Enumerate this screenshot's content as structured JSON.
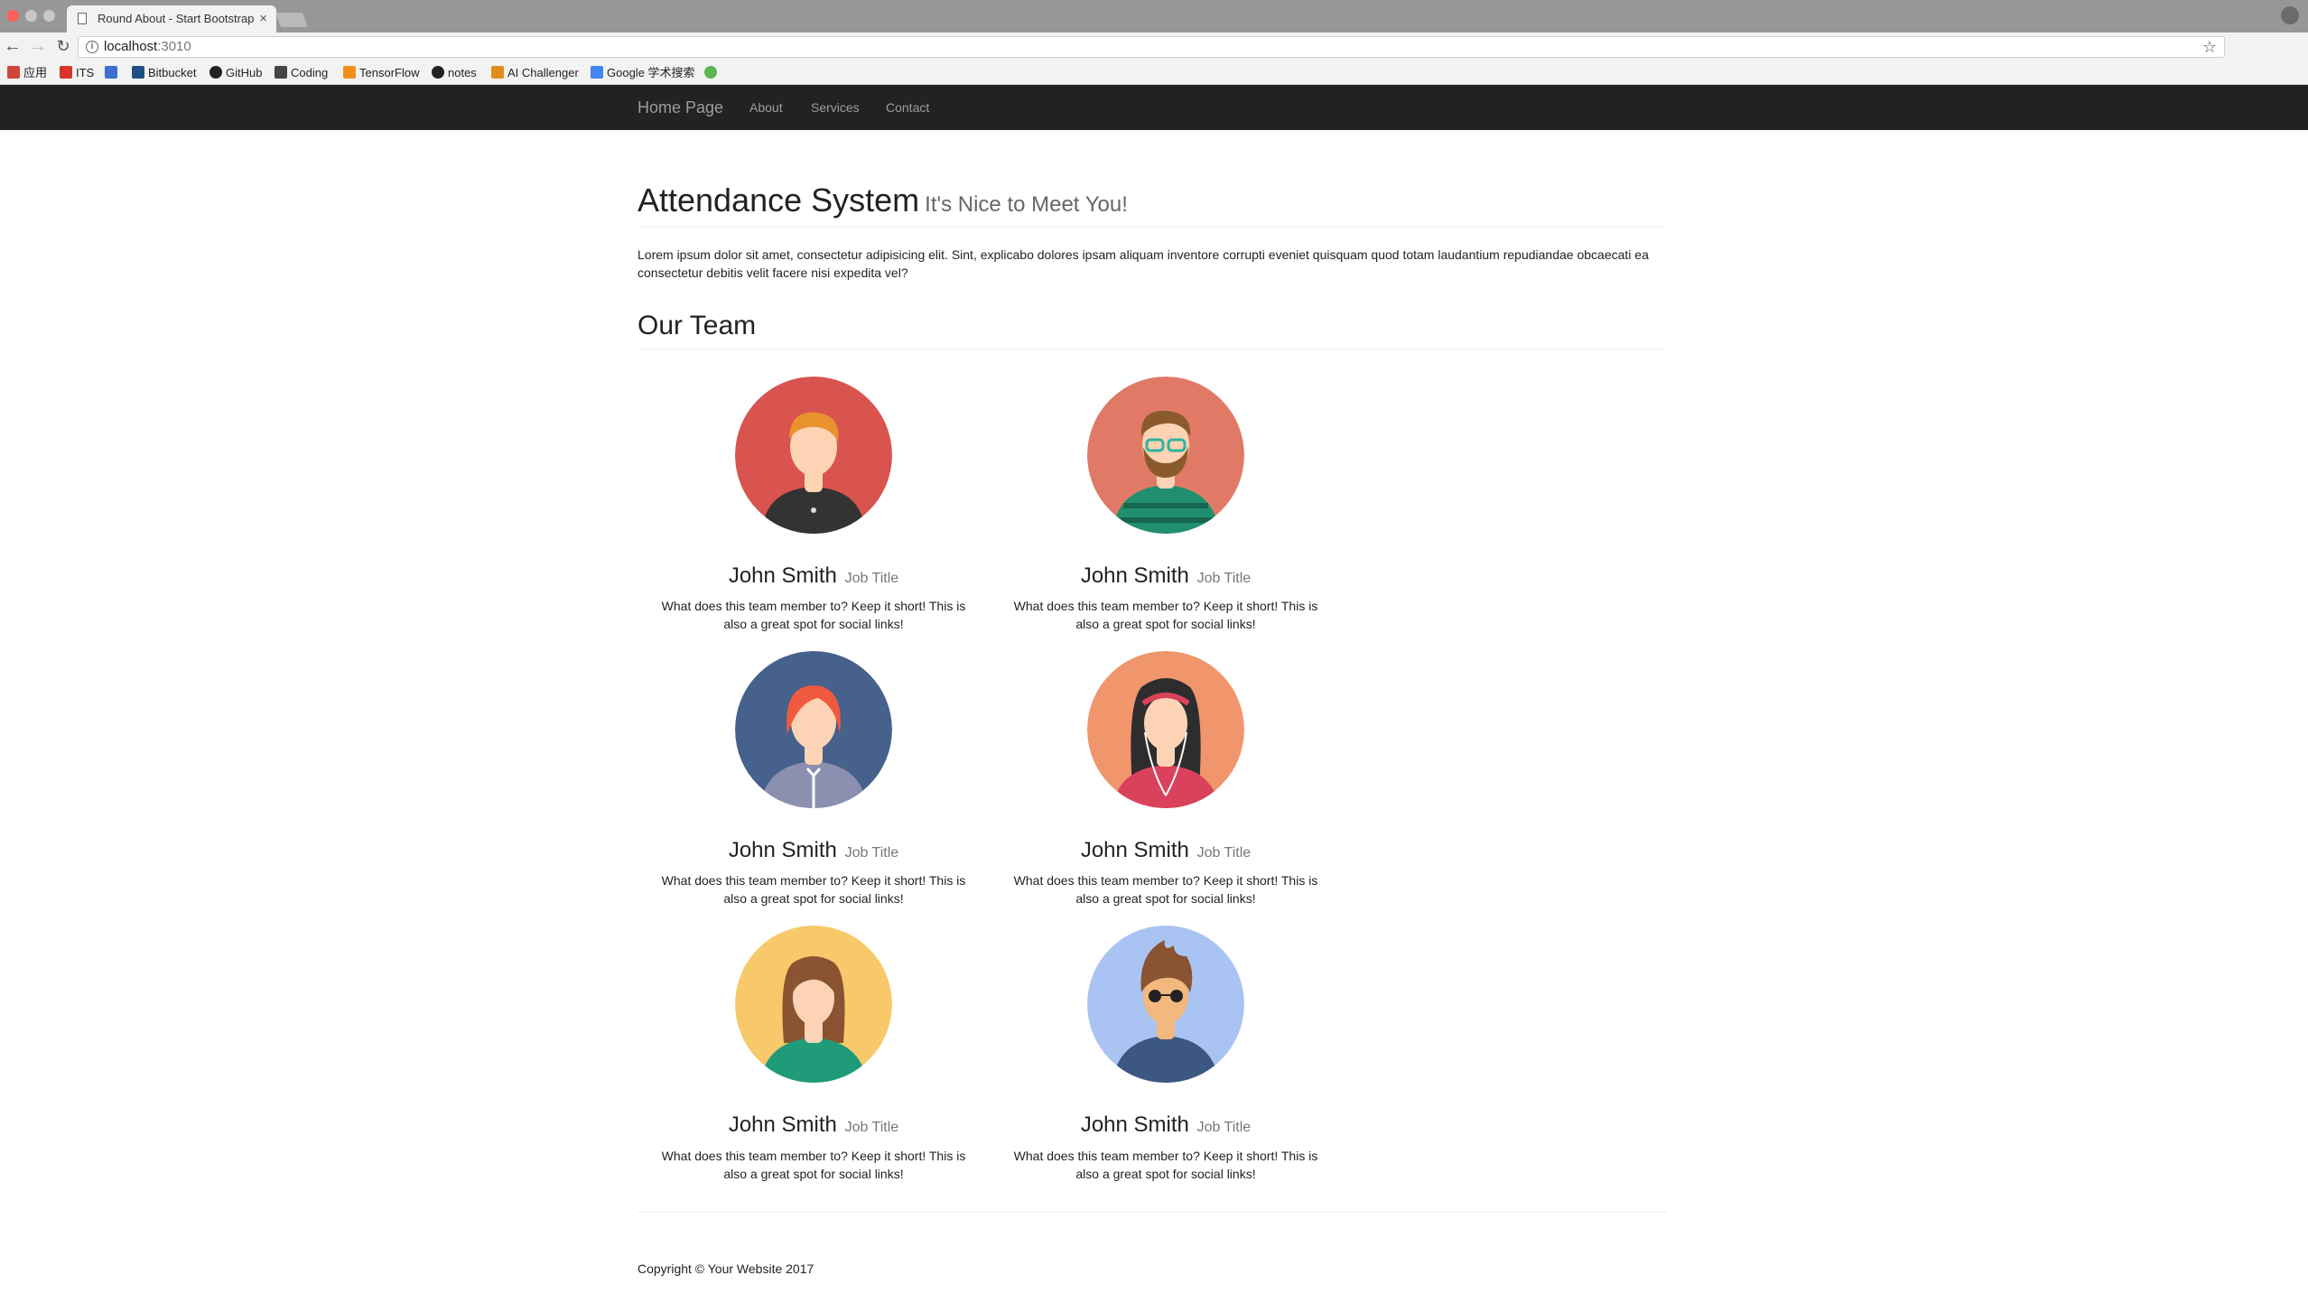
{
  "browser": {
    "tab_title": "Round About - Start Bootstrap",
    "tab_close": "×",
    "url_host": "localhost",
    "url_port": ":3010",
    "bookmarks": [
      {
        "label": "应用",
        "icon": "apps-grid-icon",
        "color": "#d0463b"
      },
      {
        "label": "ITS",
        "icon": "its-icon",
        "color": "#d8352a"
      },
      {
        "label": "",
        "icon": "blue-square-icon",
        "color": "#3b6fd1"
      },
      {
        "label": "Bitbucket",
        "icon": "bitbucket-icon",
        "color": "#205081"
      },
      {
        "label": "GitHub",
        "icon": "github-icon",
        "color": "#222222"
      },
      {
        "label": "Coding",
        "icon": "coding-icon",
        "color": "#444444"
      },
      {
        "label": "TensorFlow",
        "icon": "tensorflow-icon",
        "color": "#f0901a"
      },
      {
        "label": "notes",
        "icon": "github-icon",
        "color": "#222222"
      },
      {
        "label": "AI Challenger",
        "icon": "ai-challenger-icon",
        "color": "#e48c1b"
      },
      {
        "label": "Google 学术搜索",
        "icon": "google-scholar-icon",
        "color": "#4285f4"
      },
      {
        "label": "",
        "icon": "globe-icon",
        "color": "#5bb64f"
      }
    ]
  },
  "navbar": {
    "brand": "Home Page",
    "links": [
      "About",
      "Services",
      "Contact"
    ]
  },
  "header": {
    "title": "Attendance System",
    "subtitle": "It's Nice to Meet You!"
  },
  "intro": "Lorem ipsum dolor sit amet, consectetur adipisicing elit. Sint, explicabo dolores ipsam aliquam inventore corrupti eveniet quisquam quod totam laudantium repudiandae obcaecati ea consectetur debitis velit facere nisi expedita vel?",
  "team": {
    "heading": "Our Team",
    "members": [
      {
        "name": "John Smith",
        "title": "Job Title",
        "bio": "What does this team member to? Keep it short! This is also a great spot for social links!",
        "bg": "#d9534f"
      },
      {
        "name": "John Smith",
        "title": "Job Title",
        "bio": "What does this team member to? Keep it short! This is also a great spot for social links!",
        "bg": "#e07a66"
      },
      {
        "name": "John Smith",
        "title": "Job Title",
        "bio": "What does this team member to? Keep it short! This is also a great spot for social links!",
        "bg": "#46618b"
      },
      {
        "name": "John Smith",
        "title": "Job Title",
        "bio": "What does this team member to? Keep it short! This is also a great spot for social links!",
        "bg": "#f0956c"
      },
      {
        "name": "John Smith",
        "title": "Job Title",
        "bio": "What does this team member to? Keep it short! This is also a great spot for social links!",
        "bg": "#f7c96b"
      },
      {
        "name": "John Smith",
        "title": "Job Title",
        "bio": "What does this team member to? Keep it short! This is also a great spot for social links!",
        "bg": "#a9c3f2"
      }
    ]
  },
  "footer": {
    "copyright": "Copyright © Your Website 2017"
  }
}
